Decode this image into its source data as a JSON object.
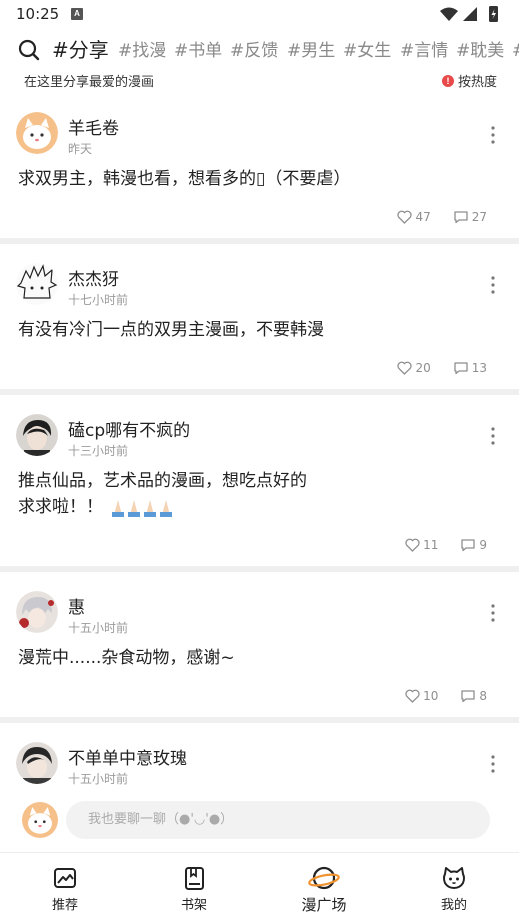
{
  "status": {
    "time": "10:25",
    "badge": "A"
  },
  "topics": {
    "active": "#分享",
    "items": [
      "#找漫",
      "#书单",
      "#反馈",
      "#男生",
      "#女生",
      "#言情",
      "#耽美",
      "#"
    ]
  },
  "subheader": {
    "description": "在这里分享最爱的漫画",
    "sort_label": "按热度",
    "sort_badge": "!"
  },
  "posts": [
    {
      "author": "羊毛卷",
      "time": "昨天",
      "content": "求双男主，韩漫也看，想看多的▯（不要虐）",
      "likes": "47",
      "comments": "27"
    },
    {
      "author": "杰杰犽",
      "time": "十七小时前",
      "content": "有没有冷门一点的双男主漫画，不要韩漫",
      "likes": "20",
      "comments": "13"
    },
    {
      "author": "磕cp哪有不疯的",
      "time": "十三小时前",
      "content_line1": "推点仙品，艺术品的漫画，想吃点好的",
      "content_line2": "求求啦！！",
      "likes": "11",
      "comments": "9"
    },
    {
      "author": "惠",
      "time": "十五小时前",
      "content": "漫荒中......杂食动物，感谢~",
      "likes": "10",
      "comments": "8"
    },
    {
      "author": "不单单中意玫瑰",
      "time": "十五小时前"
    }
  ],
  "comment": {
    "placeholder": "我也要聊一聊（●'◡'●）"
  },
  "tabs": [
    {
      "label": "推荐"
    },
    {
      "label": "书架"
    },
    {
      "label": "漫广场"
    },
    {
      "label": "我的"
    }
  ]
}
